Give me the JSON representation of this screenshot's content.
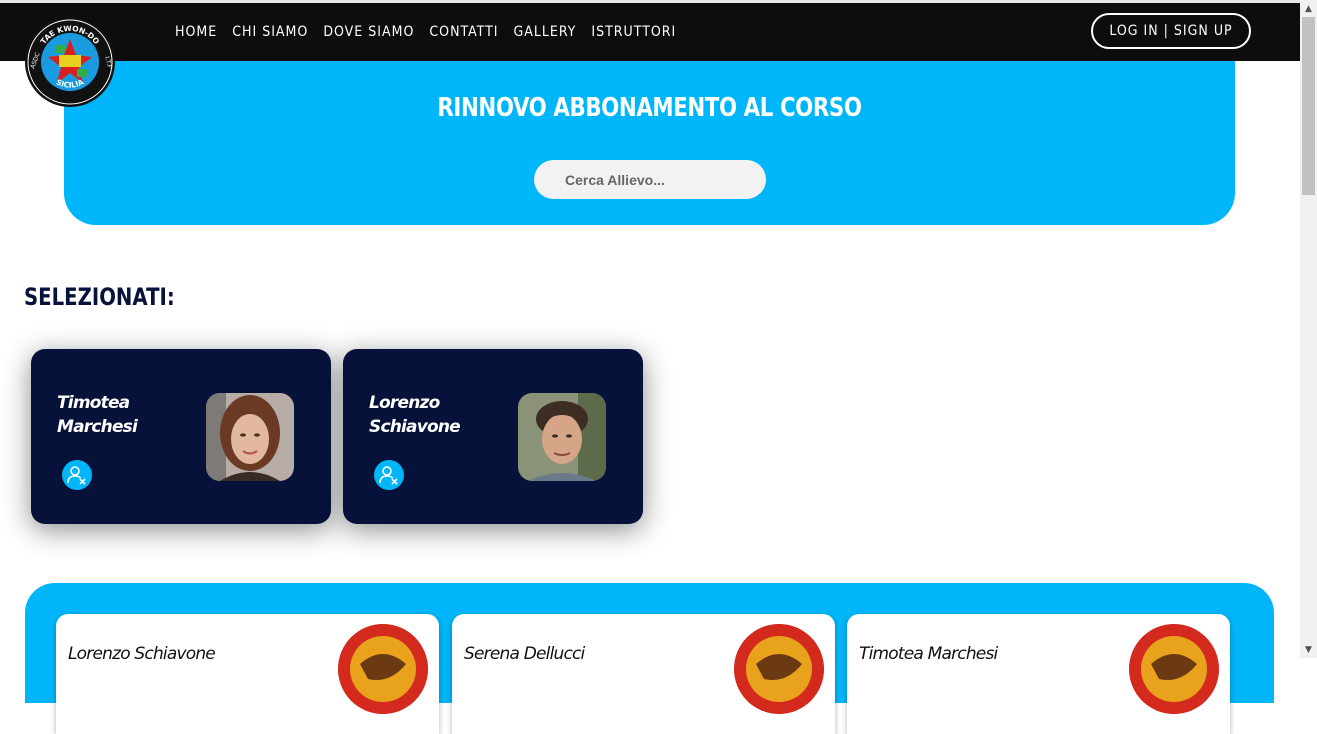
{
  "nav": {
    "items": [
      "HOME",
      "CHI SIAMO",
      "DOVE SIAMO",
      "CONTATTI",
      "GALLERY",
      "ISTRUTTORI"
    ],
    "login_label": "LOG IN | SIGN UP"
  },
  "logo": {
    "top_text": "TAE KWON-DO",
    "bottom_text": "SICILIA",
    "left_text": "ASDC",
    "right_text": "I.T.F"
  },
  "hero": {
    "title": "RINNOVO ABBONAMENTO AL CORSO",
    "search_placeholder": "Cerca Allievo..."
  },
  "selected": {
    "heading": "SELEZIONATI:",
    "cards": [
      {
        "first": "Timotea",
        "last": "Marchesi"
      },
      {
        "first": "Lorenzo",
        "last": "Schiavone"
      }
    ]
  },
  "list": {
    "cards": [
      {
        "name": "Lorenzo Schiavone"
      },
      {
        "name": "Serena Dellucci"
      },
      {
        "name": "Timotea Marchesi"
      }
    ]
  },
  "colors": {
    "accent": "#00b6fa",
    "navy": "#06123a",
    "header": "#0e0c0c"
  }
}
